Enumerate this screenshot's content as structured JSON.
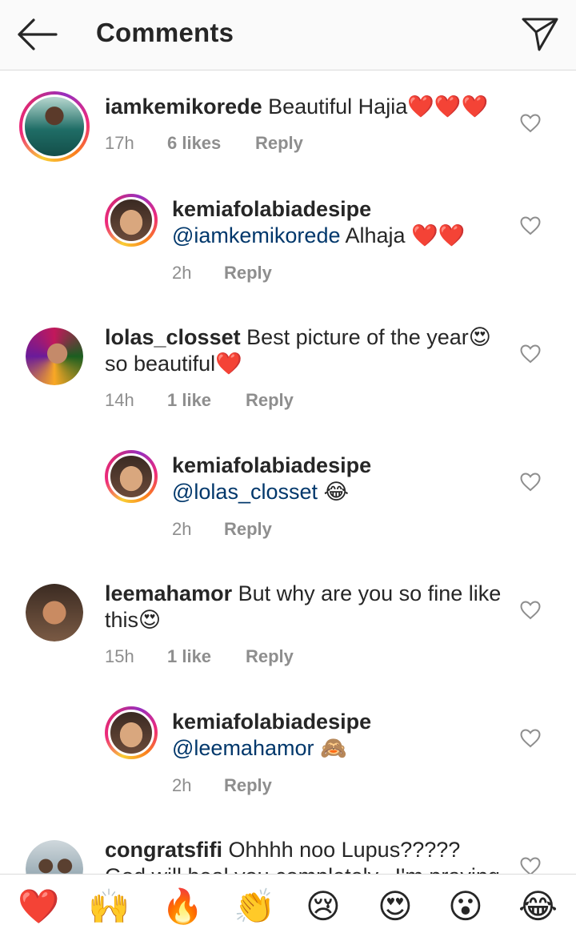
{
  "header": {
    "title": "Comments",
    "back_icon": "arrow-left-icon",
    "share_icon": "paper-plane-icon"
  },
  "comments": [
    {
      "username": "iamkemikorede",
      "text": " Beautiful Hajia❤️❤️❤️",
      "time": "17h",
      "likes": "6 likes",
      "reply": "Reply"
    },
    {
      "username": "kemiafolabiadesipe",
      "mention": "@iamkemikorede",
      "text": " Alhaja ❤️❤️",
      "time": "2h",
      "reply": "Reply"
    },
    {
      "username": "lolas_closset",
      "text": " Best picture of the year😍 so beautiful❤️",
      "time": "14h",
      "likes": "1 like",
      "reply": "Reply"
    },
    {
      "username": "kemiafolabiadesipe",
      "mention": "@lolas_closset",
      "text": " 😂",
      "time": "2h",
      "reply": "Reply"
    },
    {
      "username": "leemahamor",
      "text": " But why are you so fine like this😍",
      "time": "15h",
      "likes": "1 like",
      "reply": "Reply"
    },
    {
      "username": "kemiafolabiadesipe",
      "mention": "@leemahamor",
      "text": " 🙈",
      "time": "2h",
      "reply": "Reply"
    },
    {
      "username": "congratsfifi",
      "text": " Ohhhh noo Lupus????? God will heal you completely...I'm praying for"
    }
  ],
  "emoji_bar": [
    "❤️",
    "🙌",
    "🔥",
    "👏",
    "😢",
    "😍",
    "😮",
    "😂"
  ],
  "colors": {
    "accent_link": "#00376b",
    "meta_gray": "#8e8e8e",
    "divider": "#dbdbdb"
  }
}
